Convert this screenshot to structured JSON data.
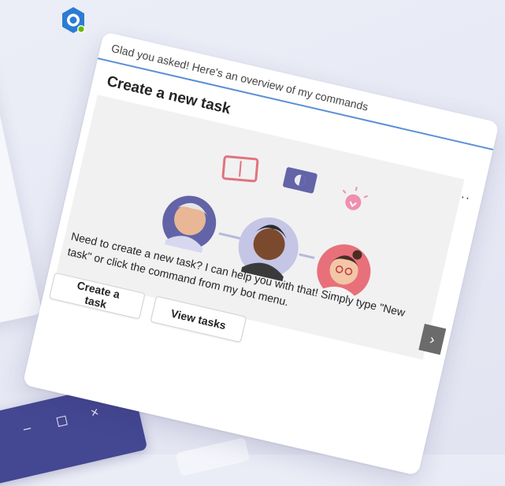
{
  "bot": {
    "avatar_icon": "bot-hexagon-icon",
    "status": "online"
  },
  "message": {
    "intro": "Glad you asked! Here's an overview of my commands"
  },
  "card": {
    "title": "Create a new task",
    "more_label": "···",
    "description": "Need to create a new task? I can help you with that! Simply type \"New task\" or click the command from my bot menu.",
    "next_label": "›",
    "buttons": {
      "create": "Create a task",
      "view": "View tasks"
    }
  },
  "window_controls": {
    "minimize": "–",
    "close": "×"
  },
  "colors": {
    "accent": "#5b8fd6",
    "brand": "#444791"
  }
}
